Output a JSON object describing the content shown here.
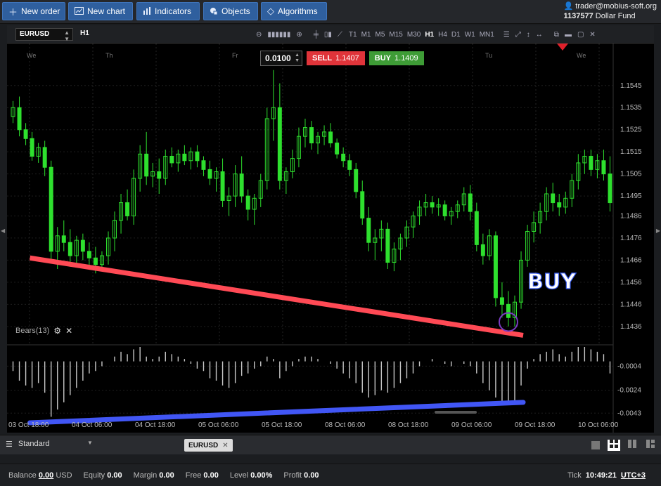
{
  "toolbar": {
    "new_order": "New order",
    "new_chart": "New chart",
    "indicators": "Indicators",
    "objects": "Objects",
    "algorithms": "Algorithms"
  },
  "account": {
    "user": "trader@mobius-soft.org",
    "number": "1137577",
    "fund": "Dollar Fund"
  },
  "chart_header": {
    "symbol": "EURUSD",
    "timeframe": "H1",
    "timeframes": [
      "T1",
      "M1",
      "M5",
      "M15",
      "M30",
      "H1",
      "H4",
      "D1",
      "W1",
      "MN1"
    ],
    "active_timeframe": "H1"
  },
  "trade": {
    "lot": "0.0100",
    "sell_label": "SELL",
    "sell_price": "1.1407",
    "buy_label": "BUY",
    "buy_price": "1.1409"
  },
  "indicator": {
    "name": "Bears(13)"
  },
  "annotation": {
    "text": "BUY"
  },
  "colors": {
    "bull_candle": "#2ee02e",
    "support_line": "#ff4a55",
    "indicator_line": "#4156f5",
    "histogram": "#c8c8c8",
    "buy_circle": "#7a3bc2"
  },
  "chart_data": {
    "type": "candlestick",
    "symbol": "EURUSD",
    "timeframe": "H1",
    "day_labels": [
      "We",
      "Th",
      "Fr",
      "Tu",
      "We"
    ],
    "price_ticks": [
      "1.1545",
      "1.1535",
      "1.1525",
      "1.1515",
      "1.1505",
      "1.1495",
      "1.1486",
      "1.1476",
      "1.1466",
      "1.1456",
      "1.1446",
      "1.1436"
    ],
    "price_range": [
      1.1428,
      1.1557
    ],
    "indicator_ticks": [
      "-0.0004",
      "-0.0024",
      "-0.0043"
    ],
    "indicator_range": [
      -0.0058,
      0.0012
    ],
    "x_ticks": [
      "03 Oct 18:00",
      "04 Oct 06:00",
      "04 Oct 18:00",
      "05 Oct 06:00",
      "05 Oct 18:00",
      "08 Oct 06:00",
      "08 Oct 18:00",
      "09 Oct 06:00",
      "09 Oct 18:00",
      "10 Oct 06:00"
    ],
    "candles": [
      [
        1.1531,
        1.1538,
        1.1528,
        1.1535
      ],
      [
        1.1535,
        1.154,
        1.1522,
        1.1525
      ],
      [
        1.1525,
        1.1528,
        1.1518,
        1.1521
      ],
      [
        1.1521,
        1.1524,
        1.1511,
        1.1513
      ],
      [
        1.1513,
        1.1519,
        1.151,
        1.1517
      ],
      [
        1.1517,
        1.152,
        1.1504,
        1.1508
      ],
      [
        1.1508,
        1.1511,
        1.1466,
        1.147
      ],
      [
        1.147,
        1.1481,
        1.1462,
        1.1477
      ],
      [
        1.1477,
        1.1484,
        1.147,
        1.1474
      ],
      [
        1.1474,
        1.148,
        1.1463,
        1.1468
      ],
      [
        1.1468,
        1.1477,
        1.1463,
        1.1475
      ],
      [
        1.1475,
        1.1478,
        1.1466,
        1.147
      ],
      [
        1.147,
        1.1474,
        1.1462,
        1.1467
      ],
      [
        1.1467,
        1.1472,
        1.146,
        1.1464
      ],
      [
        1.1464,
        1.147,
        1.1461,
        1.1468
      ],
      [
        1.1468,
        1.1479,
        1.1464,
        1.1476
      ],
      [
        1.1476,
        1.1488,
        1.147,
        1.1484
      ],
      [
        1.1484,
        1.1496,
        1.1478,
        1.1492
      ],
      [
        1.1492,
        1.1498,
        1.1484,
        1.1486
      ],
      [
        1.1486,
        1.1507,
        1.1482,
        1.1503
      ],
      [
        1.1503,
        1.1518,
        1.1497,
        1.1514
      ],
      [
        1.1514,
        1.1524,
        1.15,
        1.1504
      ],
      [
        1.1504,
        1.151,
        1.1499,
        1.1506
      ],
      [
        1.1506,
        1.1512,
        1.1496,
        1.1503
      ],
      [
        1.1503,
        1.1516,
        1.15,
        1.1513
      ],
      [
        1.1513,
        1.1517,
        1.1508,
        1.151
      ],
      [
        1.151,
        1.1516,
        1.1506,
        1.1514
      ],
      [
        1.1514,
        1.1518,
        1.1509,
        1.1511
      ],
      [
        1.1511,
        1.1517,
        1.1507,
        1.1515
      ],
      [
        1.1515,
        1.1518,
        1.1508,
        1.1511
      ],
      [
        1.1511,
        1.1513,
        1.1504,
        1.1507
      ],
      [
        1.1507,
        1.1511,
        1.15,
        1.1503
      ],
      [
        1.1503,
        1.1508,
        1.1497,
        1.1506
      ],
      [
        1.1506,
        1.1512,
        1.149,
        1.1493
      ],
      [
        1.1493,
        1.1499,
        1.1486,
        1.1495
      ],
      [
        1.1495,
        1.1509,
        1.149,
        1.1505
      ],
      [
        1.1505,
        1.1513,
        1.1492,
        1.1495
      ],
      [
        1.1495,
        1.1498,
        1.1484,
        1.1489
      ],
      [
        1.1489,
        1.1496,
        1.1482,
        1.1494
      ],
      [
        1.1494,
        1.1505,
        1.149,
        1.1502
      ],
      [
        1.1502,
        1.1535,
        1.1498,
        1.153
      ],
      [
        1.153,
        1.1552,
        1.152,
        1.1535
      ],
      [
        1.1535,
        1.1546,
        1.1498,
        1.1502
      ],
      [
        1.1502,
        1.1508,
        1.1496,
        1.1506
      ],
      [
        1.1506,
        1.1516,
        1.1503,
        1.1512
      ],
      [
        1.1512,
        1.1526,
        1.1508,
        1.1522
      ],
      [
        1.1522,
        1.153,
        1.1517,
        1.1526
      ],
      [
        1.1526,
        1.1529,
        1.1516,
        1.1519
      ],
      [
        1.1519,
        1.1524,
        1.1514,
        1.1522
      ],
      [
        1.1522,
        1.1527,
        1.1518,
        1.1524
      ],
      [
        1.1524,
        1.1528,
        1.1517,
        1.1519
      ],
      [
        1.1519,
        1.1521,
        1.1512,
        1.1514
      ],
      [
        1.1514,
        1.1517,
        1.1508,
        1.1511
      ],
      [
        1.1511,
        1.1514,
        1.1504,
        1.1507
      ],
      [
        1.1507,
        1.151,
        1.1494,
        1.1497
      ],
      [
        1.1497,
        1.1502,
        1.1482,
        1.1485
      ],
      [
        1.1485,
        1.149,
        1.147,
        1.1474
      ],
      [
        1.1474,
        1.148,
        1.1466,
        1.1476
      ],
      [
        1.1476,
        1.1484,
        1.147,
        1.148
      ],
      [
        1.148,
        1.1483,
        1.1462,
        1.1465
      ],
      [
        1.1465,
        1.1474,
        1.1461,
        1.1471
      ],
      [
        1.1471,
        1.1478,
        1.1466,
        1.1476
      ],
      [
        1.1476,
        1.1484,
        1.1472,
        1.1481
      ],
      [
        1.1481,
        1.1488,
        1.1476,
        1.1486
      ],
      [
        1.1486,
        1.1493,
        1.1482,
        1.149
      ],
      [
        1.149,
        1.1496,
        1.1486,
        1.1492
      ],
      [
        1.1492,
        1.1495,
        1.1487,
        1.149
      ],
      [
        1.149,
        1.1494,
        1.1486,
        1.1491
      ],
      [
        1.1491,
        1.1493,
        1.1484,
        1.1486
      ],
      [
        1.1486,
        1.149,
        1.1482,
        1.1488
      ],
      [
        1.1488,
        1.1493,
        1.1485,
        1.1491
      ],
      [
        1.1491,
        1.1499,
        1.1488,
        1.1496
      ],
      [
        1.1496,
        1.15,
        1.1484,
        1.1488
      ],
      [
        1.1488,
        1.1492,
        1.147,
        1.1473
      ],
      [
        1.1473,
        1.1478,
        1.1464,
        1.1468
      ],
      [
        1.1468,
        1.148,
        1.1466,
        1.1477
      ],
      [
        1.1477,
        1.1479,
        1.1445,
        1.1449
      ],
      [
        1.1449,
        1.1456,
        1.144,
        1.1446
      ],
      [
        1.1446,
        1.1452,
        1.1436,
        1.144
      ],
      [
        1.144,
        1.145,
        1.1436,
        1.1447
      ],
      [
        1.1447,
        1.147,
        1.1444,
        1.1466
      ],
      [
        1.1466,
        1.1482,
        1.1463,
        1.1479
      ],
      [
        1.1479,
        1.1488,
        1.1474,
        1.1483
      ],
      [
        1.1483,
        1.1492,
        1.1478,
        1.1488
      ],
      [
        1.1488,
        1.1499,
        1.1484,
        1.1496
      ],
      [
        1.1496,
        1.1501,
        1.1488,
        1.1492
      ],
      [
        1.1492,
        1.1496,
        1.1486,
        1.149
      ],
      [
        1.149,
        1.1497,
        1.1487,
        1.1494
      ],
      [
        1.1494,
        1.1505,
        1.149,
        1.1502
      ],
      [
        1.1502,
        1.1514,
        1.1498,
        1.151
      ],
      [
        1.151,
        1.1516,
        1.1505,
        1.1513
      ],
      [
        1.1513,
        1.1516,
        1.1504,
        1.1507
      ],
      [
        1.1507,
        1.1514,
        1.1503,
        1.1511
      ],
      [
        1.1511,
        1.1516,
        1.1502,
        1.1505
      ],
      [
        1.1505,
        1.1513,
        1.1488,
        1.1492
      ]
    ],
    "bears": [
      -0.0008,
      -0.0016,
      -0.002,
      -0.0022,
      -0.0018,
      -0.0026,
      -0.0046,
      -0.004,
      -0.0034,
      -0.0028,
      -0.0022,
      -0.0016,
      -0.001,
      -0.0008,
      -0.0004,
      0.0,
      0.0004,
      0.0008,
      0.0006,
      0.001,
      0.0012,
      0.0004,
      0.0002,
      0.0004,
      0.0008,
      0.0006,
      0.0004,
      0.0002,
      -0.0002,
      -0.0006,
      -0.0008,
      -0.0014,
      -0.0016,
      -0.002,
      -0.0022,
      -0.0018,
      -0.0012,
      -0.001,
      -0.0006,
      -0.0004,
      0.0004,
      0.0002,
      -0.0014,
      -0.0008,
      -0.0004,
      0.0002,
      0.0004,
      0.0004,
      0.0002,
      0.0,
      -0.0002,
      -0.0006,
      -0.001,
      -0.0014,
      -0.0018,
      -0.0026,
      -0.003,
      -0.0028,
      -0.0024,
      -0.0026,
      -0.0022,
      -0.0018,
      -0.0014,
      -0.001,
      -0.0004,
      0.0,
      0.0002,
      0.0,
      -0.0002,
      -0.0004,
      0.0,
      -0.0002,
      -0.0004,
      -0.001,
      -0.0018,
      -0.0024,
      -0.003,
      -0.0034,
      -0.0036,
      -0.0034,
      -0.002,
      -0.0006,
      0.0002,
      0.0006,
      0.0008,
      0.001,
      0.0006,
      0.0004,
      0.0008,
      0.0012,
      0.0012,
      0.001,
      0.0008,
      0.0006,
      -0.001
    ],
    "support_line": {
      "from": [
        0,
        1.1467
      ],
      "to": [
        79,
        1.1432
      ]
    },
    "indicator_line": {
      "from": [
        0,
        -0.0051
      ],
      "to": [
        79,
        -0.0034
      ]
    },
    "buy_marker": {
      "index": 78,
      "price": 1.1438
    }
  },
  "tabs": {
    "workspace": "Standard",
    "chart_tab": "EURUSD"
  },
  "status": {
    "balance_label": "Balance",
    "balance_value": "0.00",
    "currency": "USD",
    "equity_label": "Equity",
    "equity_value": "0.00",
    "margin_label": "Margin",
    "margin_value": "0.00",
    "free_label": "Free",
    "free_value": "0.00",
    "level_label": "Level",
    "level_value": "0.00%",
    "profit_label": "Profit",
    "profit_value": "0.00",
    "tick_label": "Tick",
    "tick_time": "10:49:21",
    "timezone": "UTC+3"
  }
}
